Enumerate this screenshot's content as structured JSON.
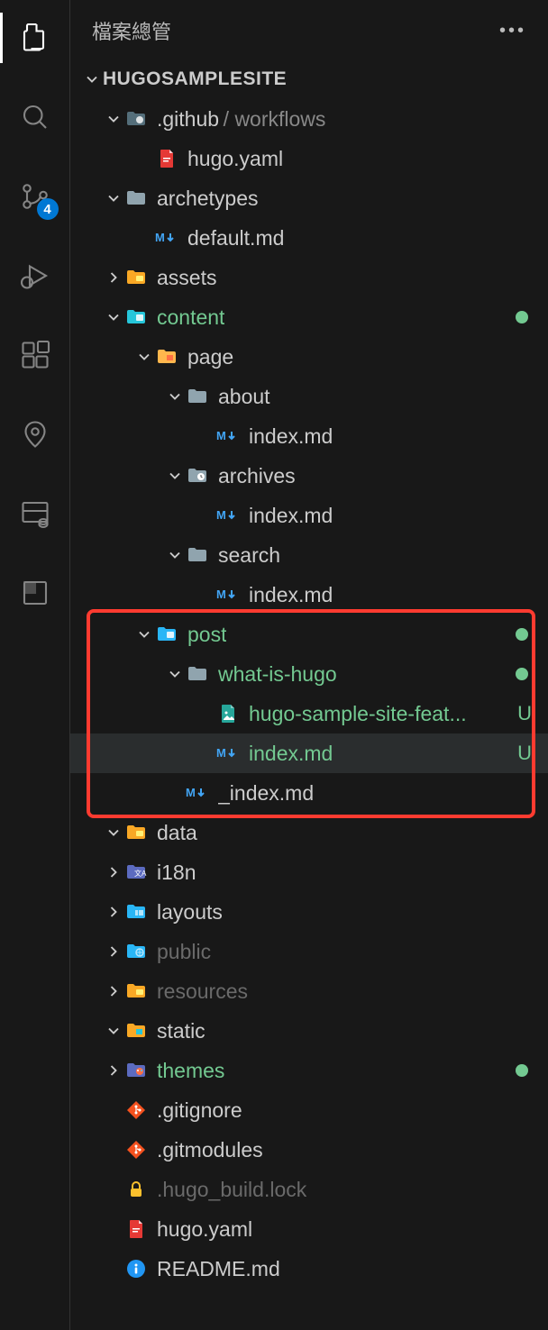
{
  "header": {
    "title": "檔案總管"
  },
  "root": {
    "label": "HUGOSAMPLESITE"
  },
  "source_control": {
    "badge": "4"
  },
  "tree": [
    {
      "kind": "folder",
      "indent": 0,
      "open": true,
      "icon": "folder-github",
      "label": ".github",
      "path_suffix": "/ workflows",
      "color": "default"
    },
    {
      "kind": "file",
      "indent": 1,
      "icon": "yaml-red",
      "label": "hugo.yaml",
      "color": "default"
    },
    {
      "kind": "folder",
      "indent": 0,
      "open": true,
      "icon": "folder-gray",
      "label": "archetypes",
      "color": "default"
    },
    {
      "kind": "file",
      "indent": 1,
      "icon": "markdown",
      "label": "default.md",
      "color": "default"
    },
    {
      "kind": "folder",
      "indent": 0,
      "open": false,
      "icon": "folder-yellow",
      "label": "assets",
      "color": "default"
    },
    {
      "kind": "folder",
      "indent": 0,
      "open": true,
      "icon": "folder-content",
      "label": "content",
      "color": "green",
      "dot": true
    },
    {
      "kind": "folder",
      "indent": 1,
      "open": true,
      "icon": "folder-orange",
      "label": "page",
      "color": "default"
    },
    {
      "kind": "folder",
      "indent": 2,
      "open": true,
      "icon": "folder-gray",
      "label": "about",
      "color": "default"
    },
    {
      "kind": "file",
      "indent": 3,
      "icon": "markdown",
      "label": "index.md",
      "color": "default"
    },
    {
      "kind": "folder",
      "indent": 2,
      "open": true,
      "icon": "folder-clock",
      "label": "archives",
      "color": "default"
    },
    {
      "kind": "file",
      "indent": 3,
      "icon": "markdown",
      "label": "index.md",
      "color": "default"
    },
    {
      "kind": "folder",
      "indent": 2,
      "open": true,
      "icon": "folder-gray",
      "label": "search",
      "color": "default"
    },
    {
      "kind": "file",
      "indent": 3,
      "icon": "markdown",
      "label": "index.md",
      "color": "default"
    },
    {
      "kind": "folder",
      "indent": 1,
      "open": true,
      "icon": "folder-post",
      "label": "post",
      "color": "green",
      "dot": true
    },
    {
      "kind": "folder",
      "indent": 2,
      "open": true,
      "icon": "folder-gray",
      "label": "what-is-hugo",
      "color": "green",
      "dot": true
    },
    {
      "kind": "file",
      "indent": 3,
      "icon": "image-green",
      "label": "hugo-sample-site-feat...",
      "color": "green",
      "status_letter": "U"
    },
    {
      "kind": "file",
      "indent": 3,
      "icon": "markdown",
      "label": "index.md",
      "color": "green",
      "status_letter": "U",
      "selected": true
    },
    {
      "kind": "file",
      "indent": 2,
      "icon": "markdown",
      "label": "_index.md",
      "color": "default"
    },
    {
      "kind": "folder",
      "indent": 0,
      "open": true,
      "icon": "folder-yellow",
      "label": "data",
      "color": "default"
    },
    {
      "kind": "folder",
      "indent": 0,
      "open": false,
      "icon": "folder-i18n",
      "label": "i18n",
      "color": "default"
    },
    {
      "kind": "folder",
      "indent": 0,
      "open": false,
      "icon": "folder-layouts",
      "label": "layouts",
      "color": "default"
    },
    {
      "kind": "folder",
      "indent": 0,
      "open": false,
      "icon": "folder-public",
      "label": "public",
      "color": "dim"
    },
    {
      "kind": "folder",
      "indent": 0,
      "open": false,
      "icon": "folder-yellow",
      "label": "resources",
      "color": "dim"
    },
    {
      "kind": "folder",
      "indent": 0,
      "open": true,
      "icon": "folder-static",
      "label": "static",
      "color": "default"
    },
    {
      "kind": "folder",
      "indent": 0,
      "open": false,
      "icon": "folder-themes",
      "label": "themes",
      "color": "green",
      "dot": true
    },
    {
      "kind": "file",
      "indent": 0,
      "icon": "git",
      "label": ".gitignore",
      "color": "default"
    },
    {
      "kind": "file",
      "indent": 0,
      "icon": "git",
      "label": ".gitmodules",
      "color": "default"
    },
    {
      "kind": "file",
      "indent": 0,
      "icon": "lock",
      "label": ".hugo_build.lock",
      "color": "dim"
    },
    {
      "kind": "file",
      "indent": 0,
      "icon": "yaml-red",
      "label": "hugo.yaml",
      "color": "default"
    },
    {
      "kind": "file",
      "indent": 0,
      "icon": "info",
      "label": "README.md",
      "color": "default"
    }
  ],
  "highlight": {
    "start_index": 13,
    "end_index": 17
  }
}
